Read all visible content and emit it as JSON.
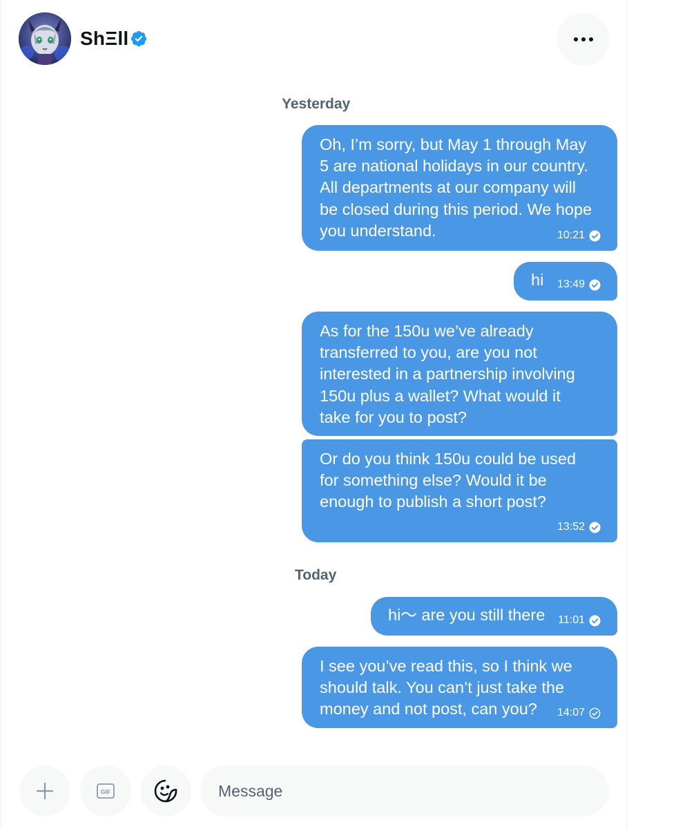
{
  "header": {
    "display_name": "ShΞll",
    "verified": true
  },
  "conversation": [
    {
      "type": "separator",
      "label": "Yesterday"
    },
    {
      "type": "message",
      "text": "Oh, I’m sorry, but May 1 through May\n5 are national holidays in our country.\nAll departments at our company will\nbe closed during this period. We hope\nyou understand.",
      "time": "10:21",
      "status": "read"
    },
    {
      "type": "message",
      "text": "hi",
      "time": "13:49",
      "status": "read"
    },
    {
      "type": "message",
      "text": "As for the 150u we’ve already\ntransferred to you, are you not\ninterested in a partnership involving\n150u plus a wallet? What would it\ntake for you to post?",
      "time": "",
      "status": ""
    },
    {
      "type": "message",
      "text": "Or do you think 150u could be used\nfor something else? Would it be\nenough to publish a short post?",
      "time": "13:52",
      "status": "read"
    },
    {
      "type": "separator",
      "label": "Today"
    },
    {
      "type": "message",
      "text": "hi～ are you still there",
      "time": "11:01",
      "status": "read"
    },
    {
      "type": "message",
      "text": "I see you’ve read this, so I think we\nshould talk. You can’t just take the\nmoney and not post, can you?",
      "time": "14:07",
      "status": "sent"
    }
  ],
  "composer": {
    "placeholder": "Message",
    "gif_label": "GIF"
  },
  "colors": {
    "bubble": "#4a97e6",
    "verified": "#1d9bf0",
    "muted_text": "#536471"
  }
}
